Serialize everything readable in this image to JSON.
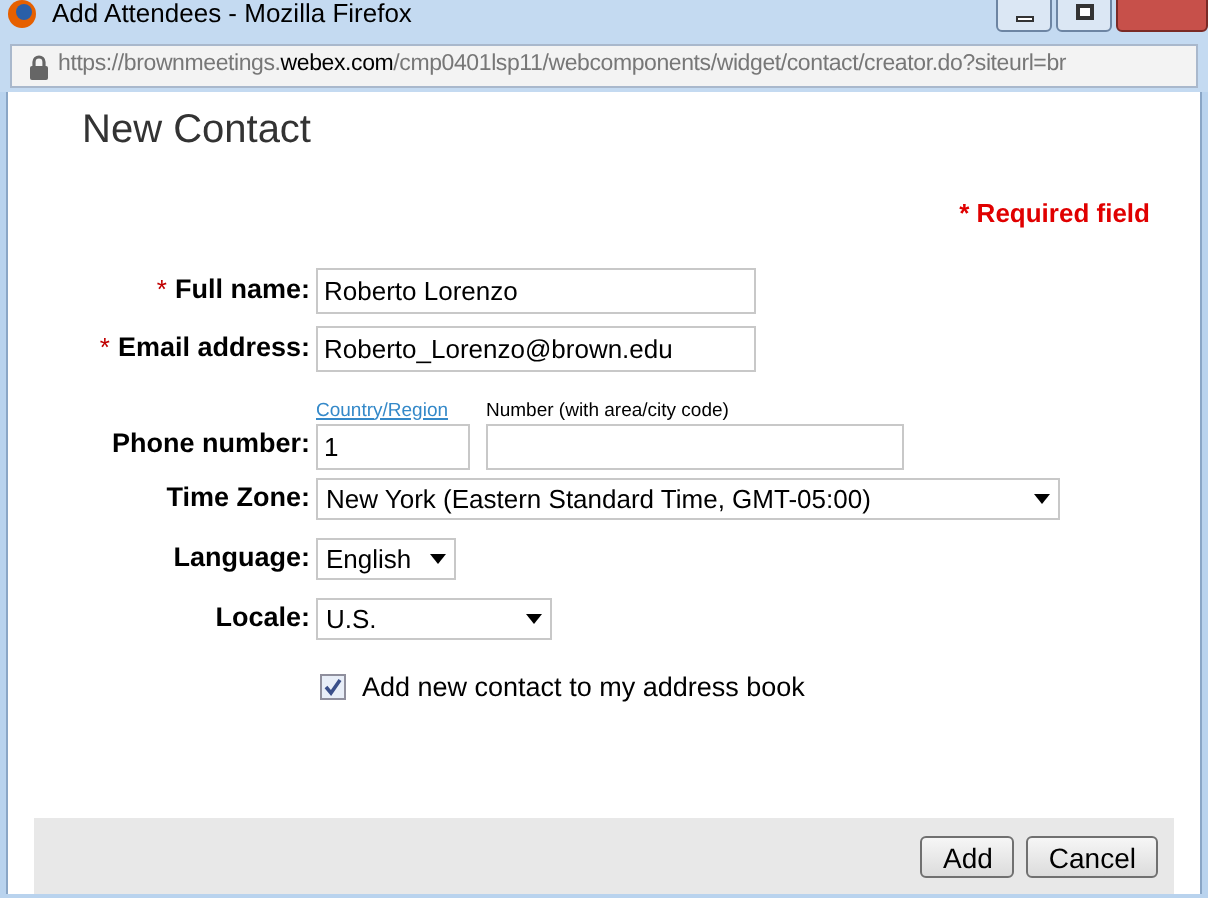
{
  "window": {
    "title": "Add Attendees - Mozilla Firefox"
  },
  "address_bar": {
    "prefix": "https://brownmeetings.",
    "domain": "webex.com",
    "path": "/cmp0401lsp11/webcomponents/widget/contact/creator.do?siteurl=br"
  },
  "heading": "New Contact",
  "required_note": "* Required field",
  "fields": [
    {
      "kind": "text",
      "label": "Full name:",
      "required": true,
      "value": "Roberto Lorenzo"
    },
    {
      "kind": "text",
      "label": "Email address:",
      "required": true,
      "value": "Roberto_Lorenzo@brown.edu"
    },
    {
      "kind": "phone",
      "label": "Phone number:",
      "required": false,
      "country_link": "Country/Region",
      "number_hint": "Number (with area/city code)",
      "country_value": "1"
    },
    {
      "kind": "select",
      "label": "Time Zone:",
      "required": false,
      "value": "New York (Eastern Standard Time, GMT-05:00)"
    },
    {
      "kind": "select",
      "label": "Language:",
      "required": false,
      "value": "English"
    },
    {
      "kind": "select",
      "label": "Locale:",
      "required": false,
      "value": "U.S."
    }
  ],
  "asterisk": "*",
  "checkbox": {
    "label": "Add new contact to my address book",
    "checked": true
  },
  "buttons": [
    "Add",
    "Cancel"
  ]
}
